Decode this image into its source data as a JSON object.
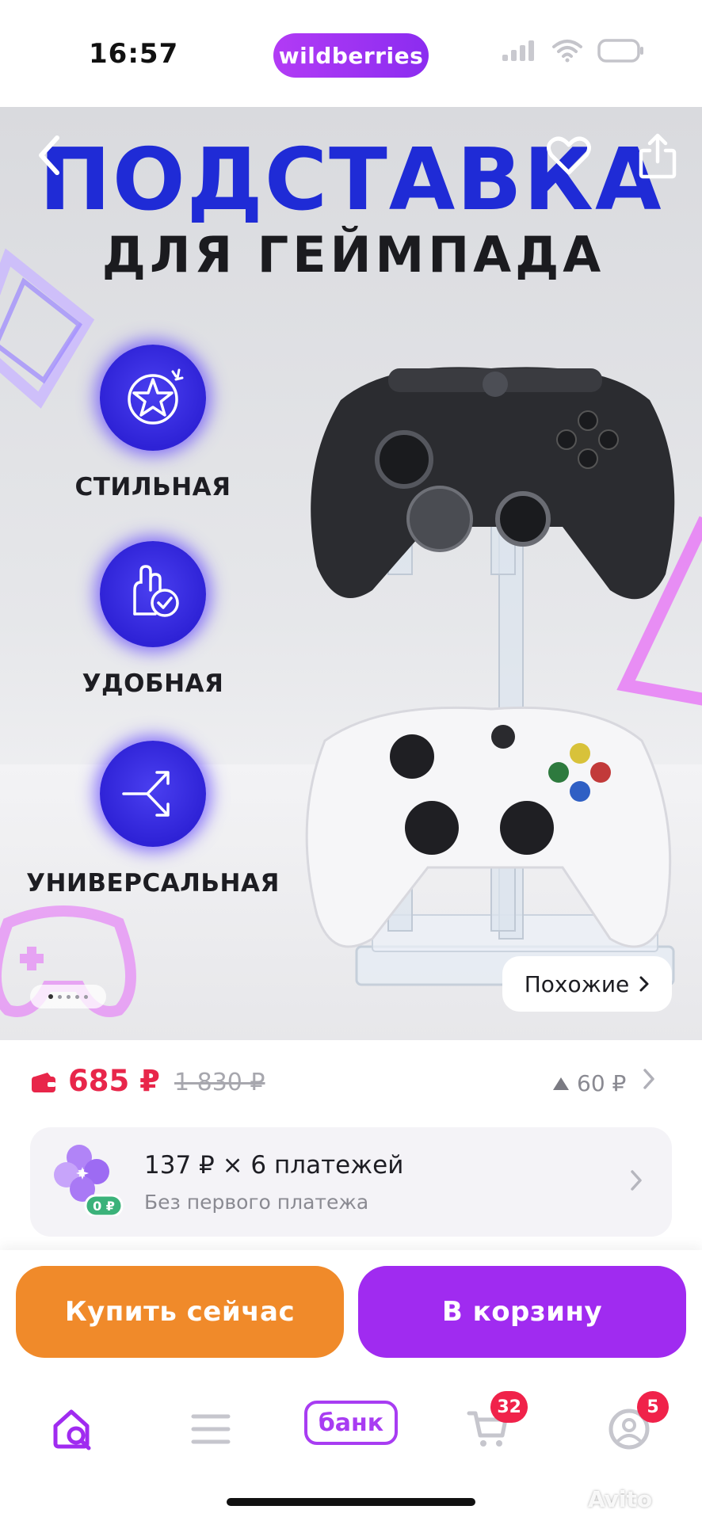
{
  "status_bar": {
    "time": "16:57",
    "brand": "wildberries"
  },
  "hero": {
    "title_line1": "ПОДСТАВКА",
    "title_line2": "ДЛЯ ГЕЙМПАДА",
    "features": [
      {
        "label": "СТИЛЬНАЯ",
        "icon": "star-badge-icon"
      },
      {
        "label": "УДОБНАЯ",
        "icon": "hand-check-icon"
      },
      {
        "label": "УНИВЕРСАЛЬНАЯ",
        "icon": "split-arrows-icon"
      }
    ],
    "similar_label": "Похожие",
    "image_index": 1,
    "image_count": 5
  },
  "price": {
    "current": "685 ₽",
    "old": "1 830 ₽",
    "delta": "60 ₽"
  },
  "installment": {
    "main": "137 ₽ × 6 платежей",
    "sub": "Без первого платежа",
    "logo_badge": "0 ₽"
  },
  "actions": {
    "buy_now": "Купить сейчас",
    "add_to_cart": "В корзину"
  },
  "tabbar": {
    "bank_label": "банк",
    "cart_badge": "32",
    "profile_badge": "5"
  },
  "watermark": "Avito",
  "colors": {
    "brand_purple": "#a02bf0",
    "buy_orange": "#f08a2a",
    "price_red": "#e8264a",
    "title_blue": "#1f2bd6"
  }
}
